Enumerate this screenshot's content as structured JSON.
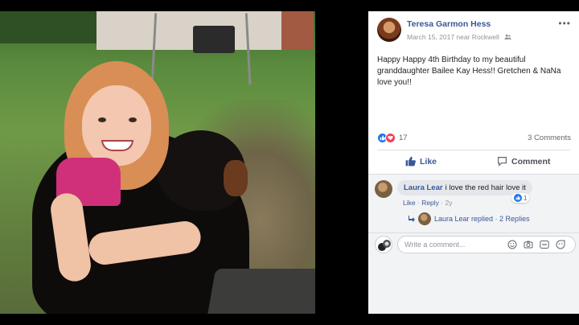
{
  "post": {
    "author": "Teresa Garmon Hess",
    "meta": "March 15, 2017 near Rockwell",
    "audience_icon": "friends-icon",
    "more_label": "•••",
    "text": "Happy Happy 4th Birthday to my beautiful granddaughter Bailee Kay Hess!! Gretchen & NaNa love you!!",
    "reaction_count": "17",
    "comments_count": "3 Comments",
    "like_label": "Like",
    "comment_label": "Comment"
  },
  "comment": {
    "author": "Laura Lear",
    "text": "i love the red hair love it",
    "like_count": "1",
    "like_link": "Like",
    "separator": "·",
    "reply_link": "Reply",
    "time": "2y"
  },
  "replies": {
    "summary": "Laura Lear replied · 2 Replies"
  },
  "composer": {
    "placeholder": "Write a comment..."
  },
  "colors": {
    "link_blue": "#385898",
    "like_blue": "#1877f2",
    "love_red": "#f33e58"
  }
}
